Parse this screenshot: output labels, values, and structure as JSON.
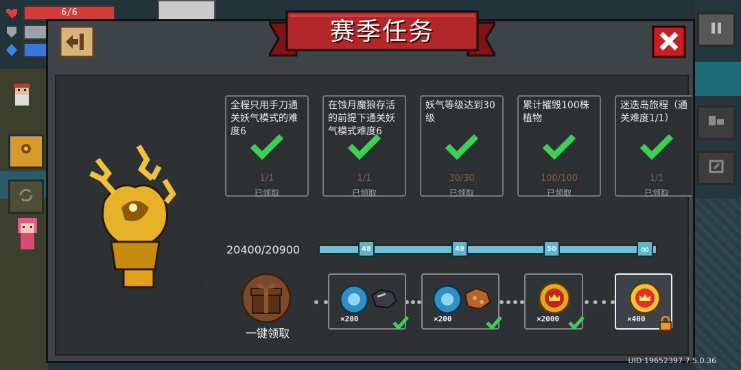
{
  "hud": {
    "hp_text": "6/6",
    "hp_fraction": 1.0,
    "armor_fraction": 1.0,
    "energy_fraction": 0.9,
    "colors": {
      "hp": "#d23b3b",
      "armor": "#9aa3a8",
      "energy": "#3a78d6"
    }
  },
  "window": {
    "title": "赛季任务",
    "back_icon": "back-arrow-icon",
    "close_icon": "close-icon"
  },
  "quests": [
    {
      "text": "全程只用手刀通关妖气模式的难度6",
      "progress": "1/1",
      "status": "已领取"
    },
    {
      "text": "在蚀月魔狼存活的前提下通关妖气模式难度6",
      "progress": "1/1",
      "status": "已领取"
    },
    {
      "text": "妖气等级达到30级",
      "progress": "30/30",
      "status": "已领取"
    },
    {
      "text": "累计摧毁100株植物",
      "progress": "100/100",
      "status": "已领取"
    },
    {
      "text": "迷迭岛旅程（通关难度1/1）",
      "progress": "1/1",
      "status": "已领取"
    }
  ],
  "season": {
    "points": "20400/20900",
    "levels": [
      "48",
      "49",
      "50",
      "∞"
    ],
    "claim_all": "一键领取"
  },
  "rewards": [
    {
      "qty": "×200",
      "items": [
        "blue-gem-icon",
        "ore-icon"
      ],
      "claimed": true
    },
    {
      "qty": "×200",
      "items": [
        "blue-gem-icon",
        "copper-ore-icon"
      ],
      "claimed": true
    },
    {
      "qty": "×2000",
      "items": [
        "gold-coin-icon"
      ],
      "claimed": true
    },
    {
      "qty": "×400",
      "items": [
        "gold-coin-icon"
      ],
      "claimed": false,
      "locked": true
    }
  ],
  "footer": {
    "uid": "UID:19652397 7.5.0.36"
  }
}
